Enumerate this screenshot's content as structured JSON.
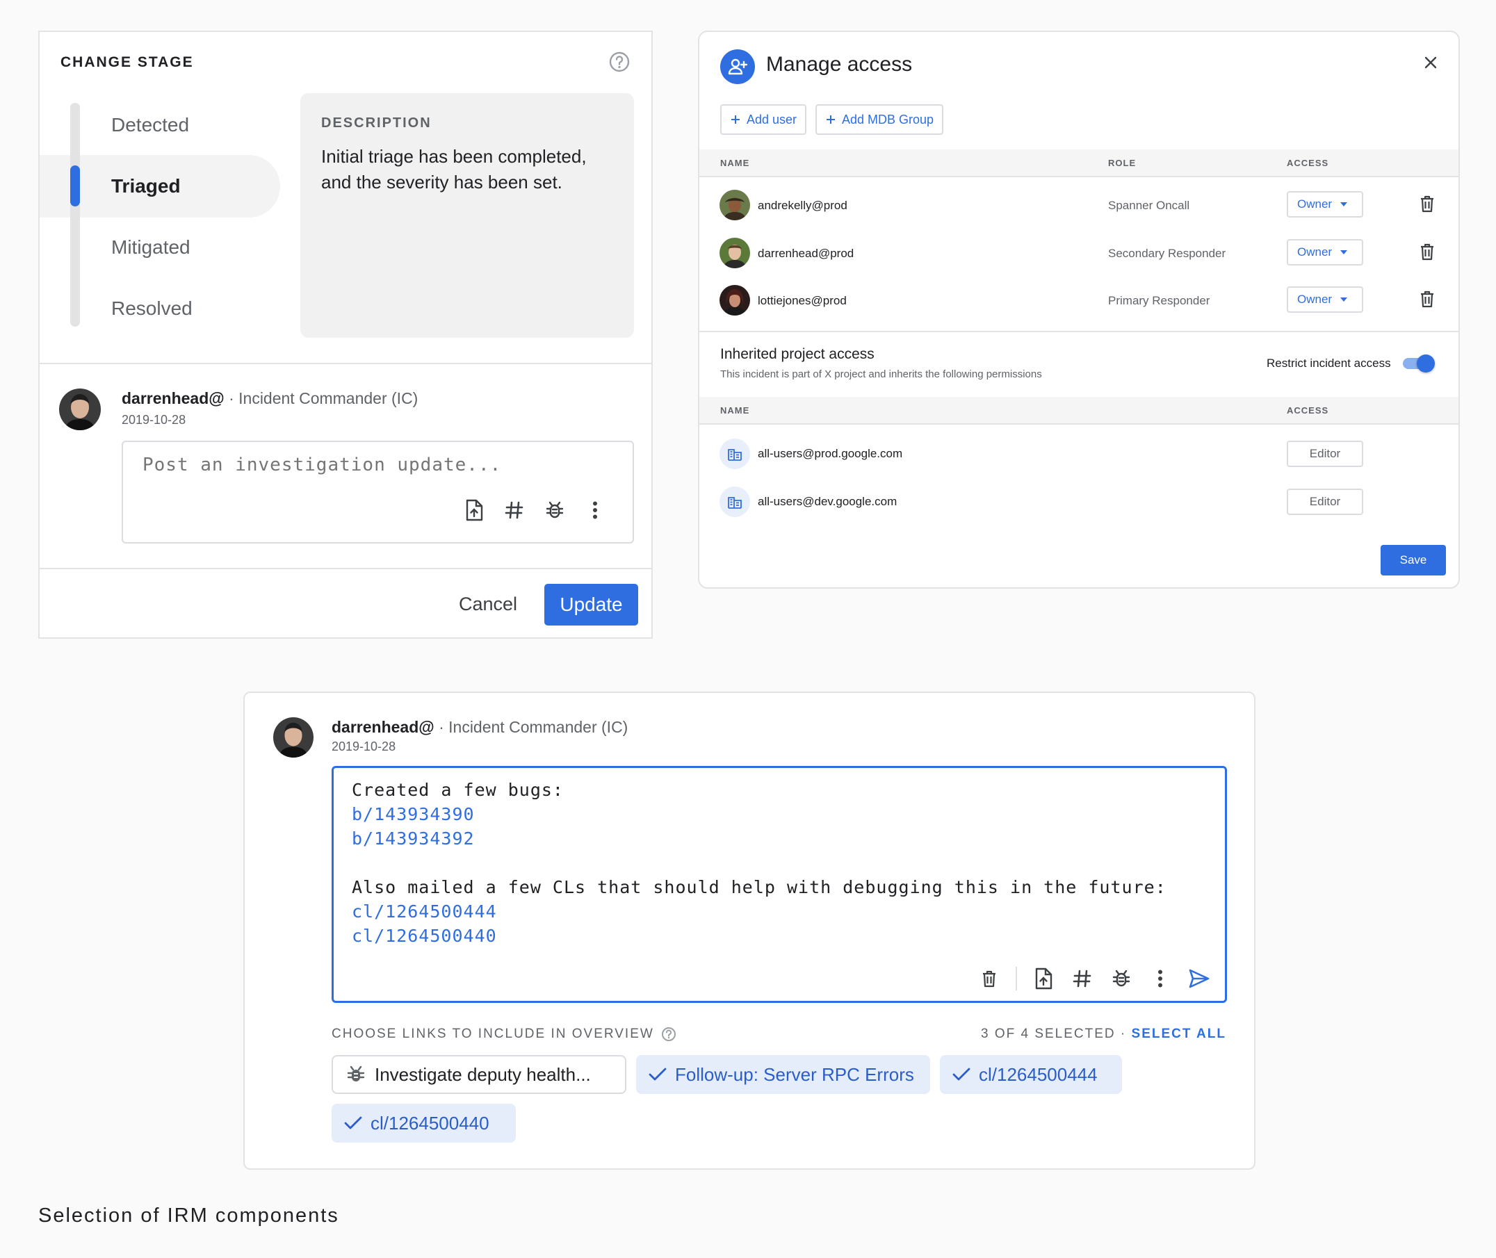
{
  "change_stage": {
    "title": "CHANGE STAGE",
    "stages": [
      "Detected",
      "Triaged",
      "Mitigated",
      "Resolved"
    ],
    "active_stage": "Triaged",
    "description_label": "DESCRIPTION",
    "description_text": "Initial triage has been completed, and the severity has been set.",
    "user": "darrenhead@",
    "role": " · Incident Commander (IC)",
    "date": "2019-10-28",
    "placeholder": "Post an investigation update...",
    "cancel_label": "Cancel",
    "update_label": "Update"
  },
  "manage_access": {
    "title": "Manage access",
    "add_user_label": "Add user",
    "add_group_label": "Add MDB Group",
    "columns": {
      "name": "NAME",
      "role": "ROLE",
      "access": "ACCESS"
    },
    "users": [
      {
        "name": "andrekelly@prod",
        "role": "Spanner Oncall",
        "access": "Owner"
      },
      {
        "name": "darrenhead@prod",
        "role": "Secondary Responder",
        "access": "Owner"
      },
      {
        "name": "lottiejones@prod",
        "role": "Primary Responder",
        "access": "Owner"
      }
    ],
    "inherited_title": "Inherited project access",
    "inherited_subtitle": "This incident is part of X project and inherits the following permissions",
    "restrict_label": "Restrict incident access",
    "restrict_on": true,
    "groups": [
      {
        "name": "all-users@prod.google.com",
        "access": "Editor"
      },
      {
        "name": "all-users@dev.google.com",
        "access": "Editor"
      }
    ],
    "save_label": "Save"
  },
  "post": {
    "user": "darrenhead@",
    "role": " · Incident Commander (IC)",
    "date": "2019-10-28",
    "lines": [
      {
        "text": "Created a few bugs:",
        "link": false
      },
      {
        "text": "b/143934390",
        "link": true
      },
      {
        "text": "b/143934392",
        "link": true
      },
      {
        "text": "",
        "link": false
      },
      {
        "text": "Also mailed a few CLs that should help with debugging this in the future:",
        "link": false
      },
      {
        "text": "cl/1264500444",
        "link": true
      },
      {
        "text": "cl/1264500440",
        "link": true
      }
    ],
    "links_label": "CHOOSE LINKS TO INCLUDE IN OVERVIEW",
    "selected_count": "3 OF 4 SELECTED",
    "select_all": "SELECT ALL",
    "chips": [
      {
        "label": "Investigate deputy health...",
        "selected": false
      },
      {
        "label": "Follow-up: Server RPC Errors",
        "selected": true
      },
      {
        "label": "cl/1264500444",
        "selected": true
      },
      {
        "label": "cl/1264500440",
        "selected": true
      }
    ]
  },
  "caption": "Selection of IRM components",
  "colors": {
    "accent": "#2f6ee0",
    "chip_selected_bg": "#e5edfb"
  }
}
